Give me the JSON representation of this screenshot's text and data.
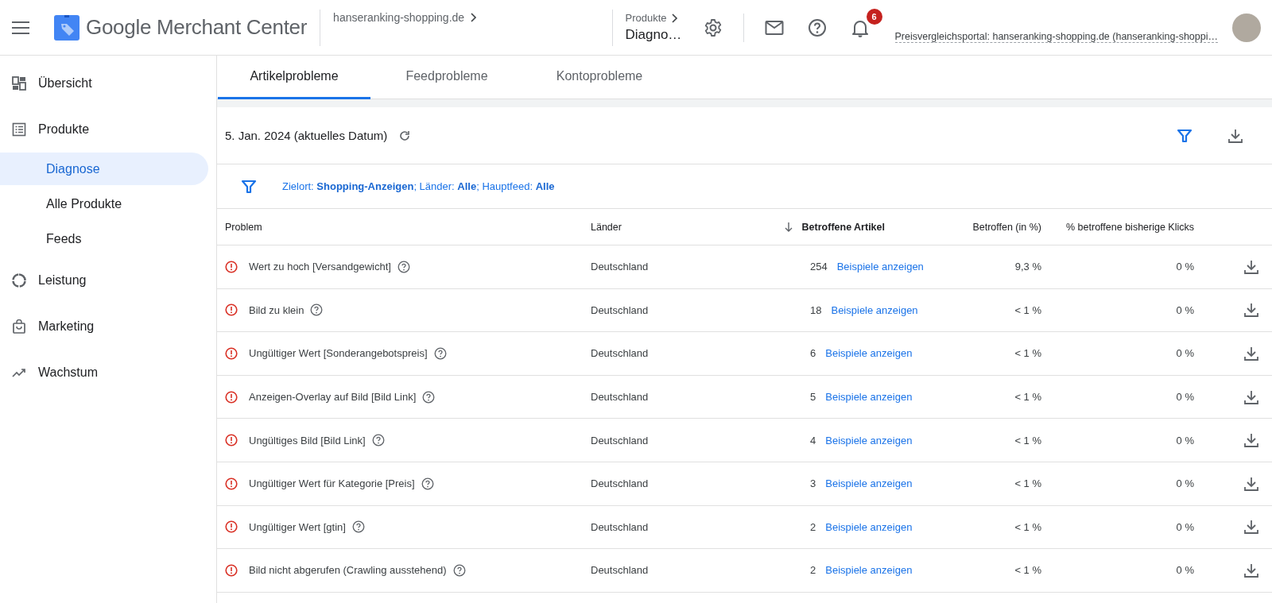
{
  "header": {
    "product_name": "Google Merchant Center",
    "account_breadcrumb": "hanseranking-shopping.de",
    "section_breadcrumb": "Produkte",
    "page_title": "Diagno…",
    "notification_count": "6",
    "account_label": "Preisvergleichsportal: hanseranking-shopping.de (hanseranking-shoppi…"
  },
  "sidebar": {
    "items": [
      {
        "label": "Übersicht",
        "selected": false
      },
      {
        "label": "Produkte",
        "selected": false,
        "children": [
          {
            "label": "Diagnose",
            "selected": true
          },
          {
            "label": "Alle Produkte",
            "selected": false
          },
          {
            "label": "Feeds",
            "selected": false
          }
        ]
      },
      {
        "label": "Leistung",
        "selected": false
      },
      {
        "label": "Marketing",
        "selected": false
      },
      {
        "label": "Wachstum",
        "selected": false
      }
    ]
  },
  "tabs": [
    {
      "label": "Artikelprobleme",
      "selected": true
    },
    {
      "label": "Feedprobleme",
      "selected": false
    },
    {
      "label": "Kontoprobleme",
      "selected": false
    }
  ],
  "date_label": "5. Jan. 2024 (aktuelles Datum)",
  "filter_summary": "Zielort: **Shopping-Anzeigen**; Länder: **Alle**; Hauptfeed: **Alle**",
  "table": {
    "columns": [
      {
        "label": "Problem",
        "sorted": false
      },
      {
        "label": "Länder",
        "sorted": false
      },
      {
        "label": "Betroffene Artikel",
        "sorted": true
      },
      {
        "label": "Betroffen (in %)",
        "sorted": false
      },
      {
        "label": "% betroffene bisherige Klicks",
        "sorted": false
      }
    ],
    "rows": [
      {
        "problem": "Wert zu hoch [Versandgewicht]",
        "country": "Deutschland",
        "count": "254",
        "link": "Beispiele anzeigen",
        "percent": "9,3 %",
        "clicks": "0 %"
      },
      {
        "problem": "Bild zu klein",
        "country": "Deutschland",
        "count": "18",
        "link": "Beispiele anzeigen",
        "percent": "< 1 %",
        "clicks": "0 %"
      },
      {
        "problem": "Ungültiger Wert [Sonderangebotspreis]",
        "country": "Deutschland",
        "count": "6",
        "link": "Beispiele anzeigen",
        "percent": "< 1 %",
        "clicks": "0 %"
      },
      {
        "problem": "Anzeigen-Overlay auf Bild [Bild Link]",
        "country": "Deutschland",
        "count": "5",
        "link": "Beispiele anzeigen",
        "percent": "< 1 %",
        "clicks": "0 %"
      },
      {
        "problem": "Ungültiges Bild [Bild Link]",
        "country": "Deutschland",
        "count": "4",
        "link": "Beispiele anzeigen",
        "percent": "< 1 %",
        "clicks": "0 %"
      },
      {
        "problem": "Ungültiger Wert für Kategorie [Preis]",
        "country": "Deutschland",
        "count": "3",
        "link": "Beispiele anzeigen",
        "percent": "< 1 %",
        "clicks": "0 %"
      },
      {
        "problem": "Ungültiger Wert [gtin]",
        "country": "Deutschland",
        "count": "2",
        "link": "Beispiele anzeigen",
        "percent": "< 1 %",
        "clicks": "0 %"
      },
      {
        "problem": "Bild nicht abgerufen (Crawling ausstehend)",
        "country": "Deutschland",
        "count": "2",
        "link": "Beispiele anzeigen",
        "percent": "< 1 %",
        "clicks": "0 %"
      }
    ]
  }
}
